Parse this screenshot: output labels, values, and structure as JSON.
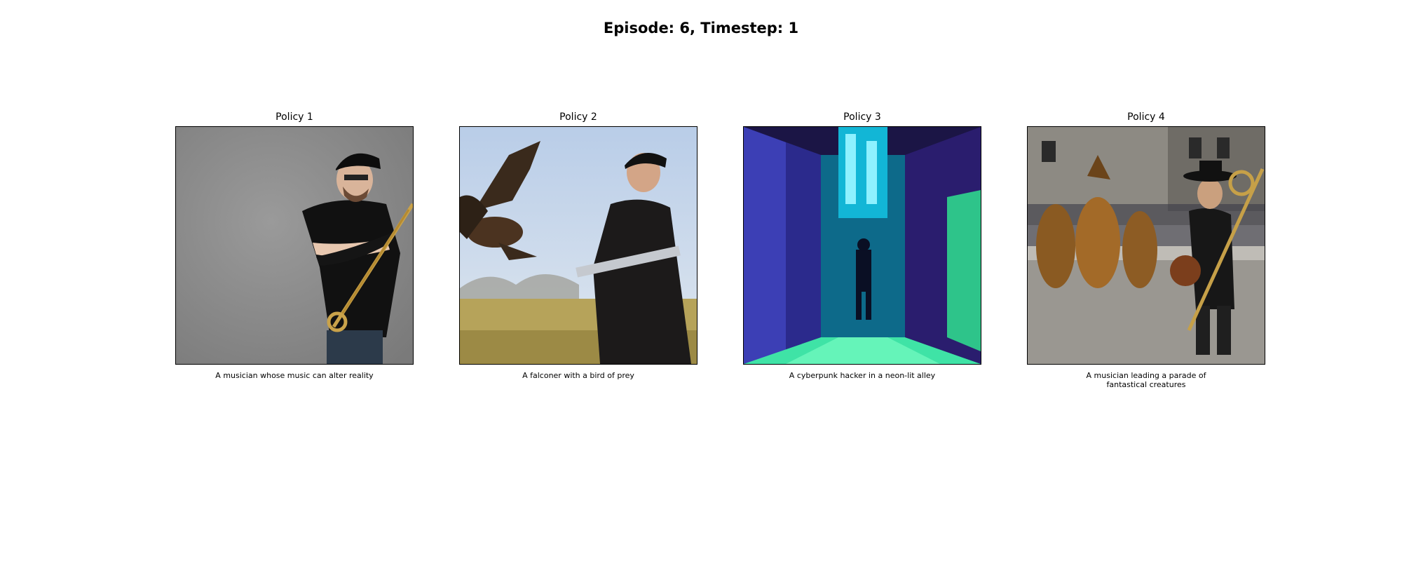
{
  "suptitle": "Episode: 6, Timestep: 1",
  "panels": [
    {
      "title": "Policy 1",
      "caption": "A musician whose music can alter reality"
    },
    {
      "title": "Policy 2",
      "caption": "A falconer with a bird of prey"
    },
    {
      "title": "Policy 3",
      "caption": "A cyberpunk hacker in a neon-lit alley"
    },
    {
      "title": "Policy 4",
      "caption": "A musician leading a parade of fantastical creatures"
    }
  ]
}
